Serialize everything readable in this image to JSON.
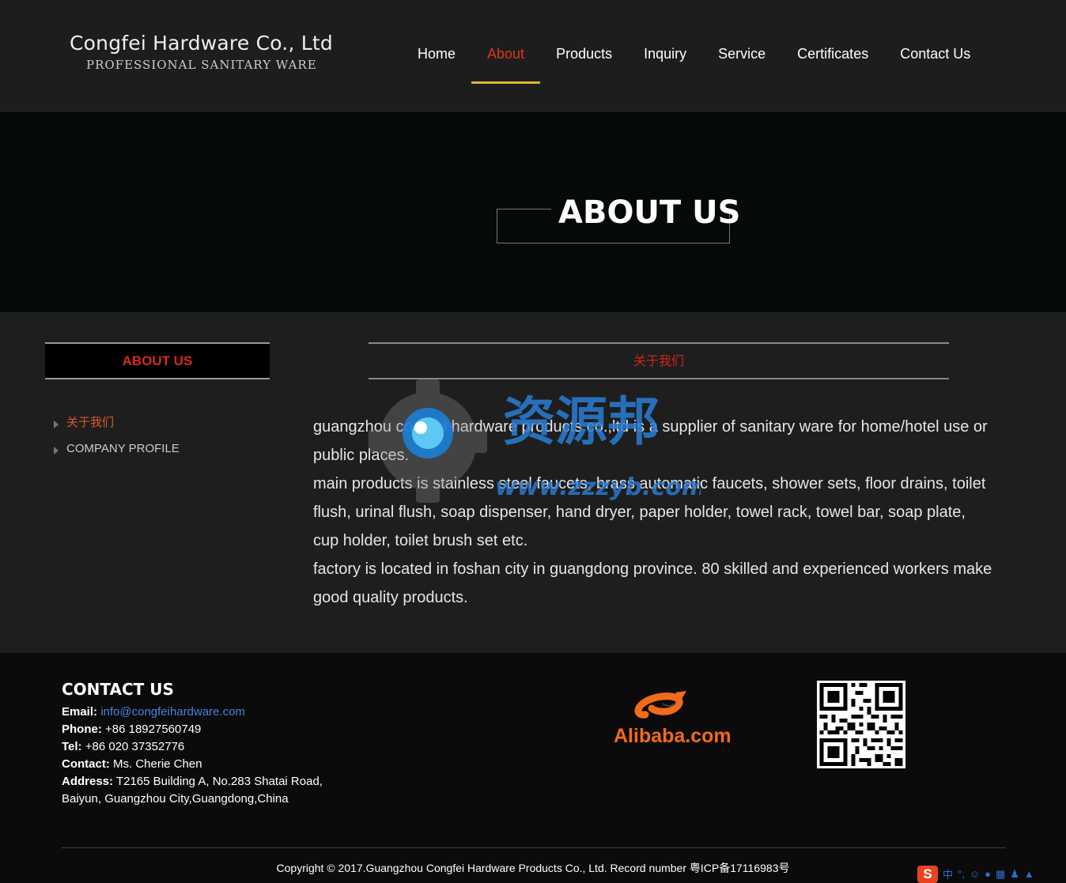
{
  "header": {
    "logo_title": "Congfei Hardware Co., Ltd",
    "logo_subtitle": "PROFESSIONAL SANITARY WARE",
    "nav": [
      "Home",
      "About",
      "Products",
      "Inquiry",
      "Service",
      "Certificates",
      "Contact Us"
    ],
    "active_nav": "About"
  },
  "banner": {
    "title": "ABOUT US"
  },
  "sidebar": {
    "heading": "ABOUT US",
    "items": [
      {
        "label": "关于我们",
        "active": true
      },
      {
        "label": "COMPANY PROFILE",
        "active": false
      }
    ]
  },
  "content": {
    "heading": "关于我们",
    "paragraphs": [
      "guangzhou congfei hardware products co.,ltd is a supplier of sanitary ware for home/hotel use or public places.",
      "main products is stainless steel faucets, brass automatic faucets, shower sets, floor drains, toilet flush, urinal flush, soap dispenser, hand dryer, paper holder, towel rack, towel bar, soap plate, cup holder, toilet brush set etc.",
      "factory is located in foshan city in guangdong province. 80 skilled and experienced workers make good quality products."
    ]
  },
  "watermark": {
    "text": "资源邦",
    "url": "www.zzzyb.com"
  },
  "footer": {
    "contact_title": "CONTACT US",
    "email_label": "Email:",
    "email": "info@congfeihardware.com",
    "phone_label": "Phone:",
    "phone": "+86 18927560749",
    "tel_label": "Tel:",
    "tel": "+86 020 37352776",
    "contact_label": "Contact:",
    "contact": "Ms. Cherie Chen",
    "address_label": "Address:",
    "address_line1": "T2165 Building A, No.283 Shatai Road,",
    "address_line2": "Baiyun, Guangzhou City,Guangdong,China",
    "partner_logo_text": "Alibaba.com",
    "copyright": "Copyright © 2017.Guangzhou Congfei Hardware Products Co., Ltd. Record number 粤ICP备17116983号"
  },
  "ime": {
    "logo": "S",
    "mode": "中"
  },
  "colors": {
    "accent_red": "#d8281c",
    "nav_active": "#d93a1a",
    "underline": "#d8b92c",
    "link": "#4a7fe0"
  }
}
